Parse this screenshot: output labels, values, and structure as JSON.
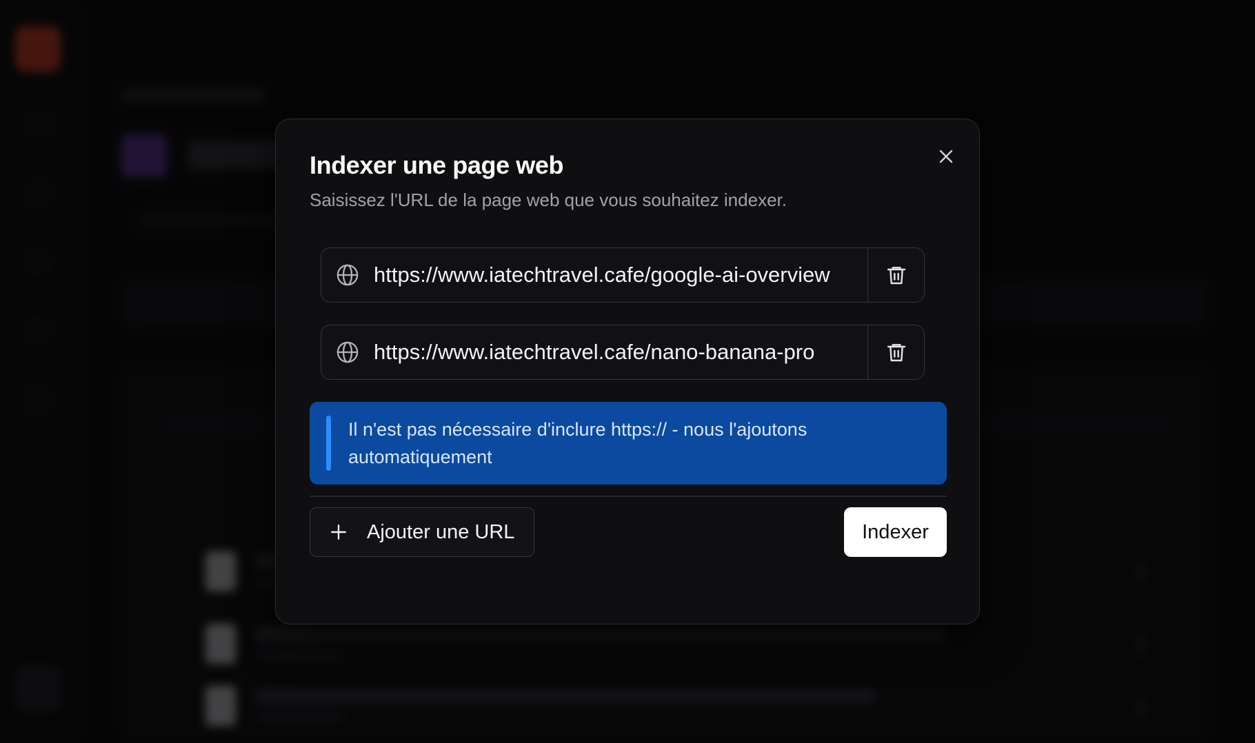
{
  "modal": {
    "title": "Indexer une page web",
    "description": "Saisissez l'URL de la page web que vous souhaitez indexer.",
    "close_icon": "close-icon",
    "urls": [
      {
        "value": "https://www.iatechtravel.cafe/google-ai-overview",
        "icon": "globe-icon",
        "action_icon": "trash-icon"
      },
      {
        "value": "https://www.iatechtravel.cafe/nano-banana-pro",
        "icon": "globe-icon",
        "action_icon": "trash-icon"
      }
    ],
    "info": {
      "text": "Il n'est pas nécessaire d'inclure https:// - nous l'ajoutons automatiquement",
      "color": "#0c4a9f",
      "accent": "#2b8cff"
    },
    "add_url_label": "Ajouter une URL",
    "submit_label": "Indexer"
  },
  "colors": {
    "background": "#0a0a0c",
    "modal_bg": "#0f0f12",
    "primary_button": "#ffffff"
  }
}
